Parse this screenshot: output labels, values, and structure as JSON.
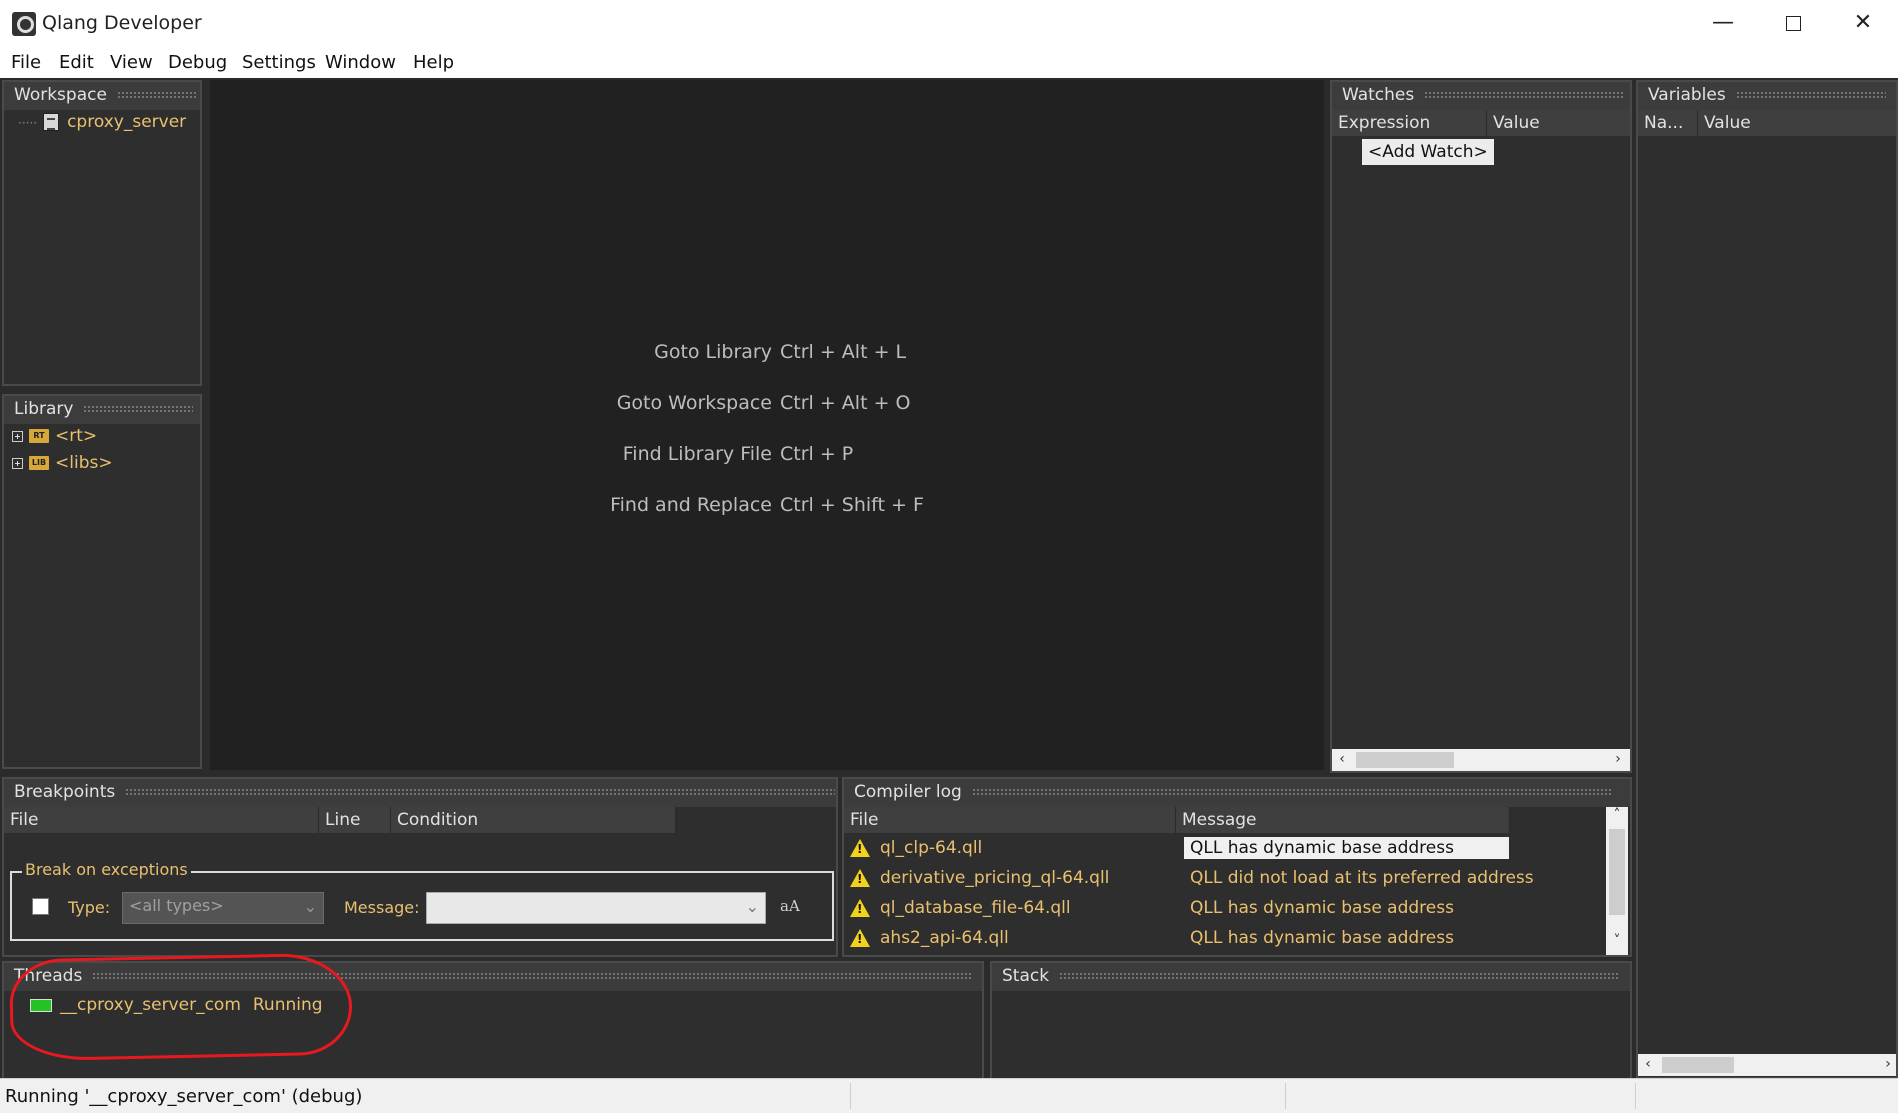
{
  "window": {
    "title": "Qlang Developer",
    "minimize": "—",
    "close": "✕"
  },
  "menu": [
    "File",
    "Edit",
    "View",
    "Debug",
    "Settings",
    "Window",
    "Help"
  ],
  "workspace": {
    "title": "Workspace",
    "items": [
      "cproxy_server"
    ]
  },
  "library": {
    "title": "Library",
    "items": [
      {
        "badge": "RT",
        "label": "<rt>"
      },
      {
        "badge": "LIB",
        "label": "<libs>"
      }
    ]
  },
  "editor": {
    "shortcuts": [
      {
        "action": "Goto Library",
        "keys": "Ctrl + Alt + L"
      },
      {
        "action": "Goto Workspace",
        "keys": "Ctrl + Alt + O"
      },
      {
        "action": "Find Library File",
        "keys": "Ctrl + P"
      },
      {
        "action": "Find and Replace",
        "keys": "Ctrl + Shift + F"
      }
    ]
  },
  "watches": {
    "title": "Watches",
    "columns": [
      "Expression",
      "Value"
    ],
    "add_watch": "<Add Watch>"
  },
  "variables": {
    "title": "Variables",
    "columns": [
      "Na...",
      "Value"
    ]
  },
  "breakpoints": {
    "title": "Breakpoints",
    "columns": [
      "File",
      "Line",
      "Condition"
    ],
    "exceptions_group": "Break on exceptions",
    "type_label": "Type:",
    "type_value": "<all types>",
    "message_label": "Message:",
    "message_value": "",
    "case_toggle": "aA"
  },
  "compiler_log": {
    "title": "Compiler log",
    "columns": [
      "File",
      "Message"
    ],
    "rows": [
      {
        "file": "ql_clp-64.qll",
        "message": "QLL has dynamic base address"
      },
      {
        "file": "derivative_pricing_ql-64.qll",
        "message": "QLL did not load at its preferred address"
      },
      {
        "file": "ql_database_file-64.qll",
        "message": "QLL has dynamic base address"
      },
      {
        "file": "ahs2_api-64.qll",
        "message": "QLL has dynamic base address"
      }
    ]
  },
  "threads": {
    "title": "Threads",
    "items": [
      {
        "name": "__cproxy_server_com",
        "state": "Running"
      }
    ]
  },
  "stack": {
    "title": "Stack"
  },
  "status": {
    "text": "Running '__cproxy_server_com' (debug)"
  },
  "colors": {
    "accent_text": "#e8c070",
    "panel_bg": "#2e2e2e",
    "editor_bg": "#212121",
    "running_indicator": "#22c322",
    "annotation": "#e8191e"
  }
}
